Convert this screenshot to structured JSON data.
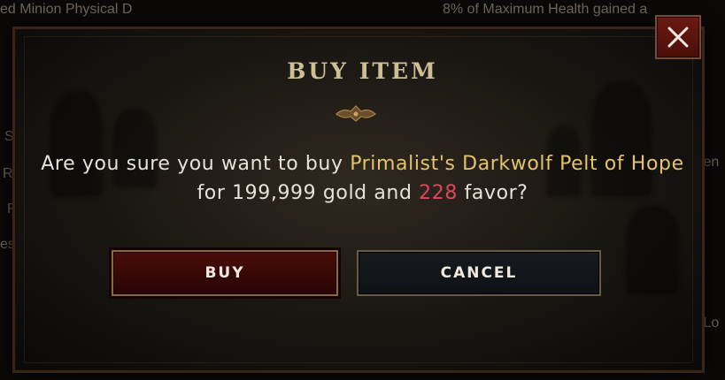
{
  "background": {
    "top_left": "ed Minion Physical D",
    "top_right": "8% of Maximum Health gained a",
    "left_s": "S",
    "left_r": "R",
    "left_f": "F",
    "left_es": "es",
    "right_ten": "ten",
    "right_sl": "s Lo"
  },
  "modal": {
    "title": "BUY ITEM",
    "message": {
      "prefix": "Are you sure you want to buy ",
      "item_name": "Primalist's Darkwolf Pelt of Hope",
      "middle": " for 199,999 gold and ",
      "favor": "228",
      "suffix": " favor?"
    },
    "buttons": {
      "buy": "BUY",
      "cancel": "CANCEL"
    }
  },
  "icons": {
    "close": "close-icon",
    "divider": "ornament-divider-icon"
  },
  "colors": {
    "item_name": "#e3c46d",
    "favor": "#e0455c",
    "title": "#cdbf94"
  }
}
